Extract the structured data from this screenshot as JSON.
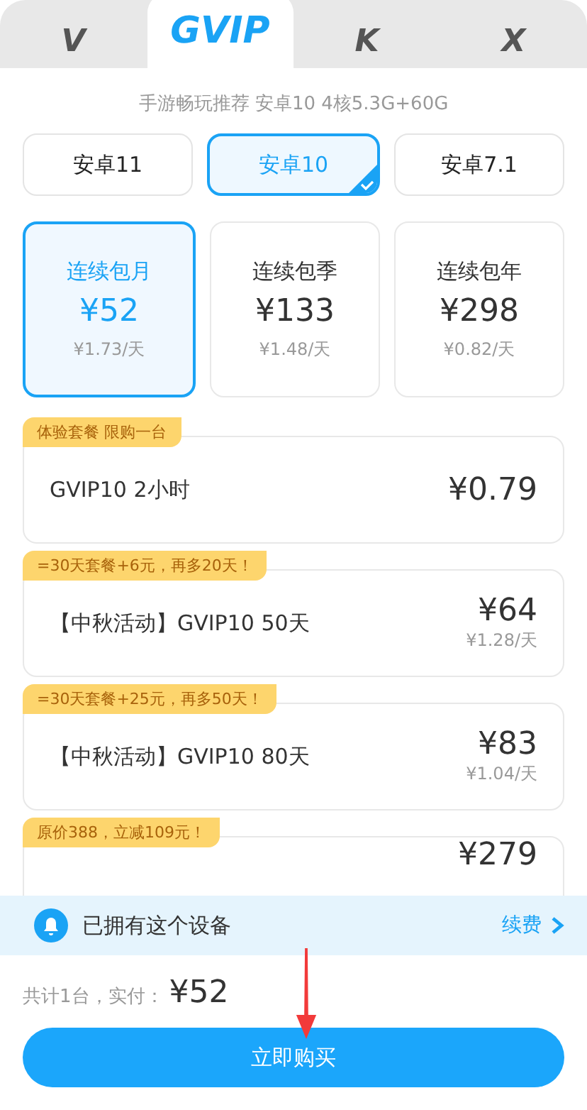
{
  "tabs": [
    {
      "label": "V",
      "selected": false
    },
    {
      "label": "GVIP",
      "selected": true
    },
    {
      "label": "K",
      "selected": false
    },
    {
      "label": "X",
      "selected": false
    }
  ],
  "subtitle": "手游畅玩推荐 安卓10 4核5.3G+60G",
  "os_options": [
    {
      "label": "安卓11",
      "selected": false
    },
    {
      "label": "安卓10",
      "selected": true
    },
    {
      "label": "安卓7.1",
      "selected": false
    }
  ],
  "plans": [
    {
      "name": "连续包月",
      "price": "¥52",
      "per_day": "¥1.73/天",
      "selected": true
    },
    {
      "name": "连续包季",
      "price": "¥133",
      "per_day": "¥1.48/天",
      "selected": false
    },
    {
      "name": "连续包年",
      "price": "¥298",
      "per_day": "¥0.82/天",
      "selected": false
    }
  ],
  "packages": [
    {
      "tag": "体验套餐 限购一台",
      "title": "GVIP10 2小时",
      "price": "¥0.79"
    },
    {
      "tag": "=30天套餐+6元，再多20天！",
      "title": "【中秋活动】GVIP10 50天",
      "price": "¥64",
      "per_day": "¥1.28/天"
    },
    {
      "tag": "=30天套餐+25元，再多50天！",
      "title": "【中秋活动】GVIP10 80天",
      "price": "¥83",
      "per_day": "¥1.04/天"
    },
    {
      "tag": "原价388，立减109元！",
      "price": "¥279"
    }
  ],
  "notice": {
    "text": "已拥有这个设备",
    "link": "续费"
  },
  "total": {
    "label": "共计1台，实付：",
    "amount": "¥52"
  },
  "buy_button": "立即购买"
}
